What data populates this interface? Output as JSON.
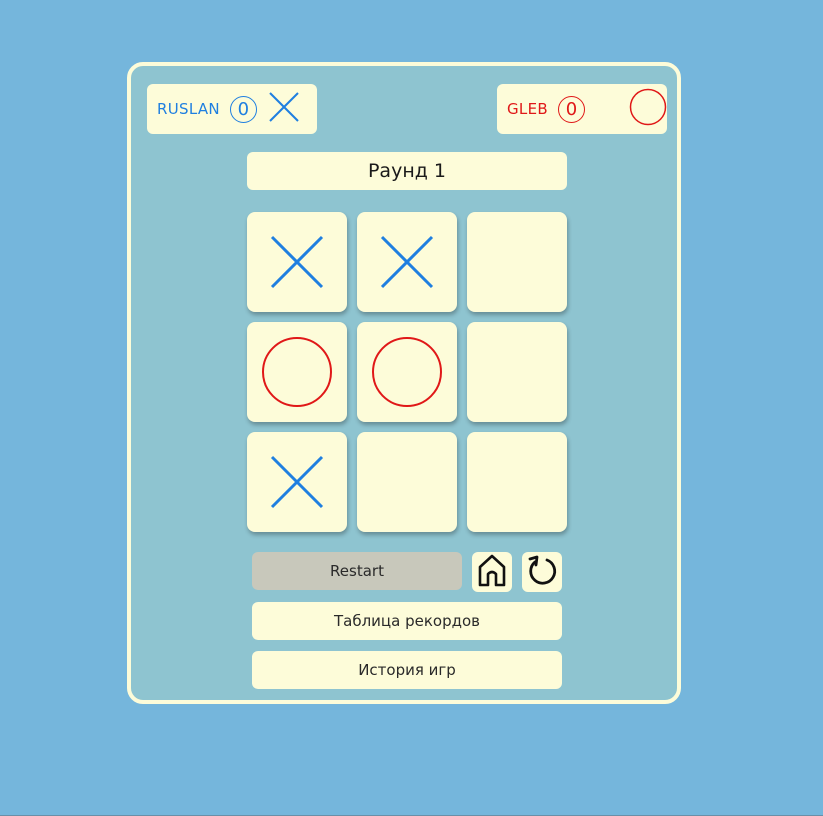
{
  "players": [
    {
      "name": "RUSLAN",
      "score": "0",
      "symbol": "x",
      "color": "#1f7fe0"
    },
    {
      "name": "GLEB",
      "score": "0",
      "symbol": "o",
      "color": "#e01818"
    }
  ],
  "round_label": "Раунд 1",
  "board": [
    "x",
    "x",
    "",
    "o",
    "o",
    "",
    "x",
    "",
    ""
  ],
  "buttons": {
    "restart": "Restart",
    "records": "Таблица рекордов",
    "history": "История игр"
  },
  "icons": {
    "home": "home-icon",
    "undo": "undo-icon"
  },
  "colors": {
    "background": "#75b6dc",
    "panel": "#8ec4d0",
    "cell": "#fdfcd9",
    "x": "#1f7fe0",
    "o": "#e01818"
  }
}
